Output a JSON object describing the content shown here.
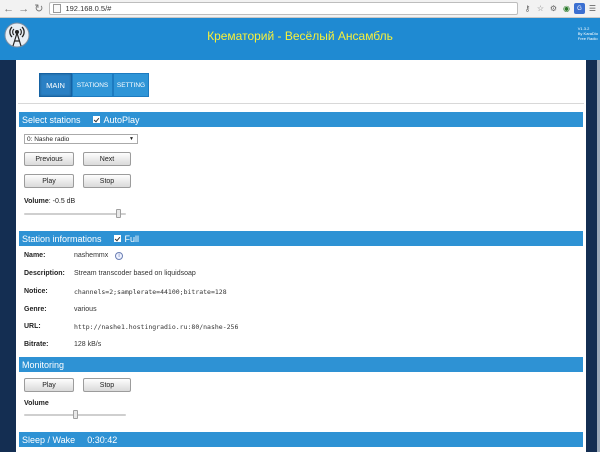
{
  "browser": {
    "url": "192.168.0.5/#",
    "icons": [
      "key-icon",
      "bookmark-star-icon",
      "cookie-icon",
      "globe-icon",
      "translate-icon",
      "menu-icon"
    ]
  },
  "header": {
    "title": "Крематорий - Весёлый Ансамбль",
    "version": "V1.3.2",
    "credit_1": "By KaraDio",
    "credit_2": "Free Radio"
  },
  "tabs": [
    {
      "label": "MAIN",
      "active": true
    },
    {
      "label": "STATIONS",
      "active": false
    },
    {
      "label": "SETTING",
      "active": false
    }
  ],
  "select_stations": {
    "title": "Select stations",
    "autoplay_label": "AutoPlay",
    "autoplay_checked": true,
    "station_value": "0: Nashe radio",
    "previous_label": "Previous",
    "next_label": "Next",
    "play_label": "Play",
    "stop_label": "Stop",
    "volume_label": "Volume",
    "volume_value": ": -0.5 dB",
    "volume_level": 0.95
  },
  "station_info": {
    "title": "Station informations",
    "full_label": "Full",
    "full_checked": true,
    "rows": [
      {
        "label": "Name:",
        "value": "nashemmx"
      },
      {
        "label": "Description:",
        "value": "Stream transcoder based on liquidsoap"
      },
      {
        "label": "Notice:",
        "value": "channels=2;samplerate=44100;bitrate=128"
      },
      {
        "label": "Genre:",
        "value": "various"
      },
      {
        "label": "URL:",
        "value": "http://nashe1.hostingradio.ru:80/nashe-256"
      },
      {
        "label": "Bitrate:",
        "value": "128 kB/s"
      }
    ]
  },
  "monitoring": {
    "title": "Monitoring",
    "play_label": "Play",
    "stop_label": "Stop",
    "volume_label": "Volume",
    "volume_level": 0.5
  },
  "sleep": {
    "title": "Sleep / Wake",
    "timer": "0:30:42"
  }
}
